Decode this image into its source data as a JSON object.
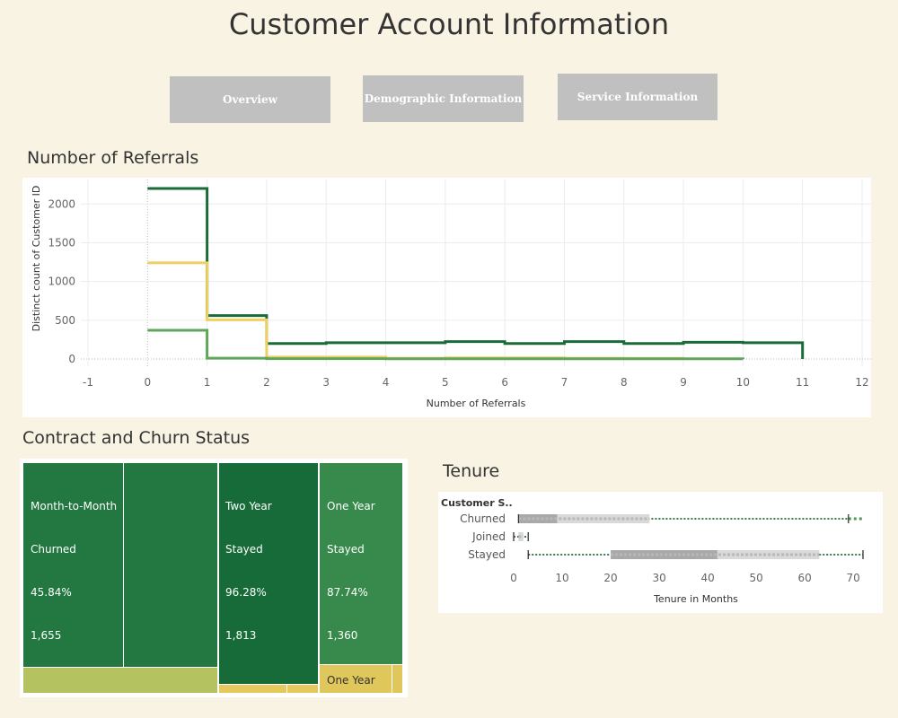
{
  "page": {
    "title": "Customer Account Information"
  },
  "nav": {
    "overview": "Overview",
    "demographic": "Demographic Information",
    "service": "Service Information"
  },
  "colors": {
    "background": "#f9f3e4",
    "nav_button": "#c0c0c0",
    "churned": "#1b6b38",
    "stayed_yellow": "#edcf62",
    "joined_green": "#5fa55a"
  },
  "referrals": {
    "section_title": "Number of Referrals",
    "xlabel": "Number of Referrals",
    "ylabel": "Distinct count of Customer ID"
  },
  "contract": {
    "section_title": "Contract and Churn Status",
    "cells": [
      {
        "line1": "Month-to-Month",
        "line2": "Churned",
        "line3": "45.84%",
        "line4": "1,655"
      },
      {
        "line1": "Two Year",
        "line2": "Stayed",
        "line3": "96.28%",
        "line4": "1,813"
      },
      {
        "line1": "One Year",
        "line2": "Stayed",
        "line3": "87.74%",
        "line4": "1,360"
      },
      {
        "line1": "One Year"
      }
    ]
  },
  "tenure": {
    "section_title": "Tenure",
    "header": "Customer S..",
    "categories": [
      "Churned",
      "Joined",
      "Stayed"
    ],
    "xlabel": "Tenure in Months",
    "ticks": [
      "0",
      "10",
      "20",
      "30",
      "40",
      "50",
      "60",
      "70"
    ]
  },
  "chart_data": [
    {
      "type": "line",
      "title": "Number of Referrals",
      "xlabel": "Number of Referrals",
      "ylabel": "Distinct count of Customer ID",
      "xlim": [
        -1,
        12
      ],
      "ylim": [
        0,
        2200
      ],
      "x_ticks": [
        -1,
        0,
        1,
        2,
        3,
        4,
        5,
        6,
        7,
        8,
        9,
        10,
        11,
        12
      ],
      "y_ticks": [
        0,
        500,
        1000,
        1500,
        2000
      ],
      "grid": true,
      "step": true,
      "series": [
        {
          "color": "#1b6b38",
          "x": [
            0,
            1,
            2,
            3,
            4,
            5,
            6,
            7,
            8,
            9,
            10,
            11
          ],
          "values": [
            2200,
            560,
            200,
            210,
            210,
            225,
            200,
            225,
            200,
            215,
            210,
            0
          ]
        },
        {
          "color": "#edcf62",
          "x": [
            0,
            1,
            2,
            3,
            4,
            5,
            6,
            7,
            8,
            9
          ],
          "values": [
            1240,
            505,
            25,
            25,
            10,
            15,
            15,
            10,
            8,
            0
          ]
        },
        {
          "color": "#5fa55a",
          "x": [
            0,
            1,
            2,
            3,
            4,
            5,
            6,
            7,
            8,
            9,
            10
          ],
          "values": [
            370,
            10,
            5,
            5,
            3,
            3,
            3,
            3,
            3,
            3,
            0
          ]
        }
      ]
    },
    {
      "type": "heatmap",
      "title": "Contract and Churn Status",
      "cells": [
        {
          "contract": "Month-to-Month",
          "status": "Churned",
          "percent": 45.84,
          "count": 1655
        },
        {
          "contract": "Two Year",
          "status": "Stayed",
          "percent": 96.28,
          "count": 1813
        },
        {
          "contract": "One Year",
          "status": "Stayed",
          "percent": 87.74,
          "count": 1360
        }
      ]
    },
    {
      "type": "box",
      "title": "Tenure",
      "xlabel": "Tenure in Months",
      "xlim": [
        0,
        72
      ],
      "categories": [
        "Churned",
        "Joined",
        "Stayed"
      ],
      "boxes": [
        {
          "name": "Churned",
          "min": 1,
          "q1": 1,
          "median": 9,
          "q3": 28,
          "max": 69
        },
        {
          "name": "Joined",
          "min": 0,
          "q1": 1,
          "median": 1,
          "q3": 2,
          "max": 3
        },
        {
          "name": "Stayed",
          "min": 3,
          "q1": 20,
          "median": 42,
          "q3": 63,
          "max": 72
        }
      ]
    }
  ]
}
